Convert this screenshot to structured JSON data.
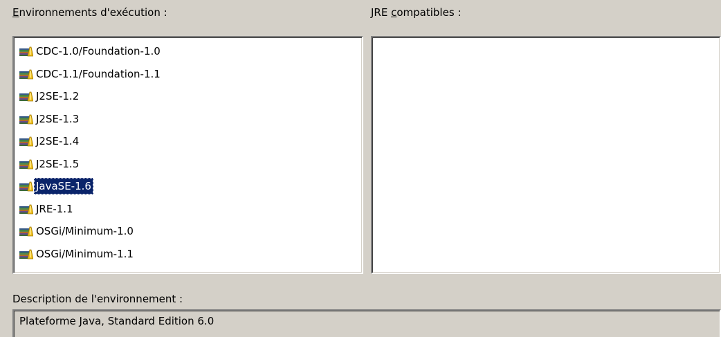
{
  "environments": {
    "label_mnemonic": "E",
    "label_rest": "nvironnements d'exécution :",
    "items": [
      {
        "label": "CDC-1.0/Foundation-1.0",
        "icon": "library-books-icon"
      },
      {
        "label": "CDC-1.1/Foundation-1.1",
        "icon": "library-books-icon"
      },
      {
        "label": "J2SE-1.2",
        "icon": "library-books-icon"
      },
      {
        "label": "J2SE-1.3",
        "icon": "library-books-icon"
      },
      {
        "label": "J2SE-1.4",
        "icon": "library-books-icon"
      },
      {
        "label": "J2SE-1.5",
        "icon": "library-books-icon"
      },
      {
        "label": "JavaSE-1.6",
        "icon": "library-books-icon",
        "selected": true
      },
      {
        "label": "JRE-1.1",
        "icon": "library-books-icon"
      },
      {
        "label": "OSGi/Minimum-1.0",
        "icon": "library-books-icon"
      },
      {
        "label": "OSGi/Minimum-1.1",
        "icon": "library-books-icon"
      }
    ]
  },
  "compatible_jres": {
    "label_prefix": "JRE ",
    "label_mnemonic": "c",
    "label_rest": "ompatibles :",
    "items": []
  },
  "description": {
    "label": "Description de l'environnement :",
    "value": "Plateforme Java, Standard Edition 6.0"
  },
  "colors": {
    "selection_bg": "#0a246a",
    "dialog_bg": "#d4d0c8"
  }
}
